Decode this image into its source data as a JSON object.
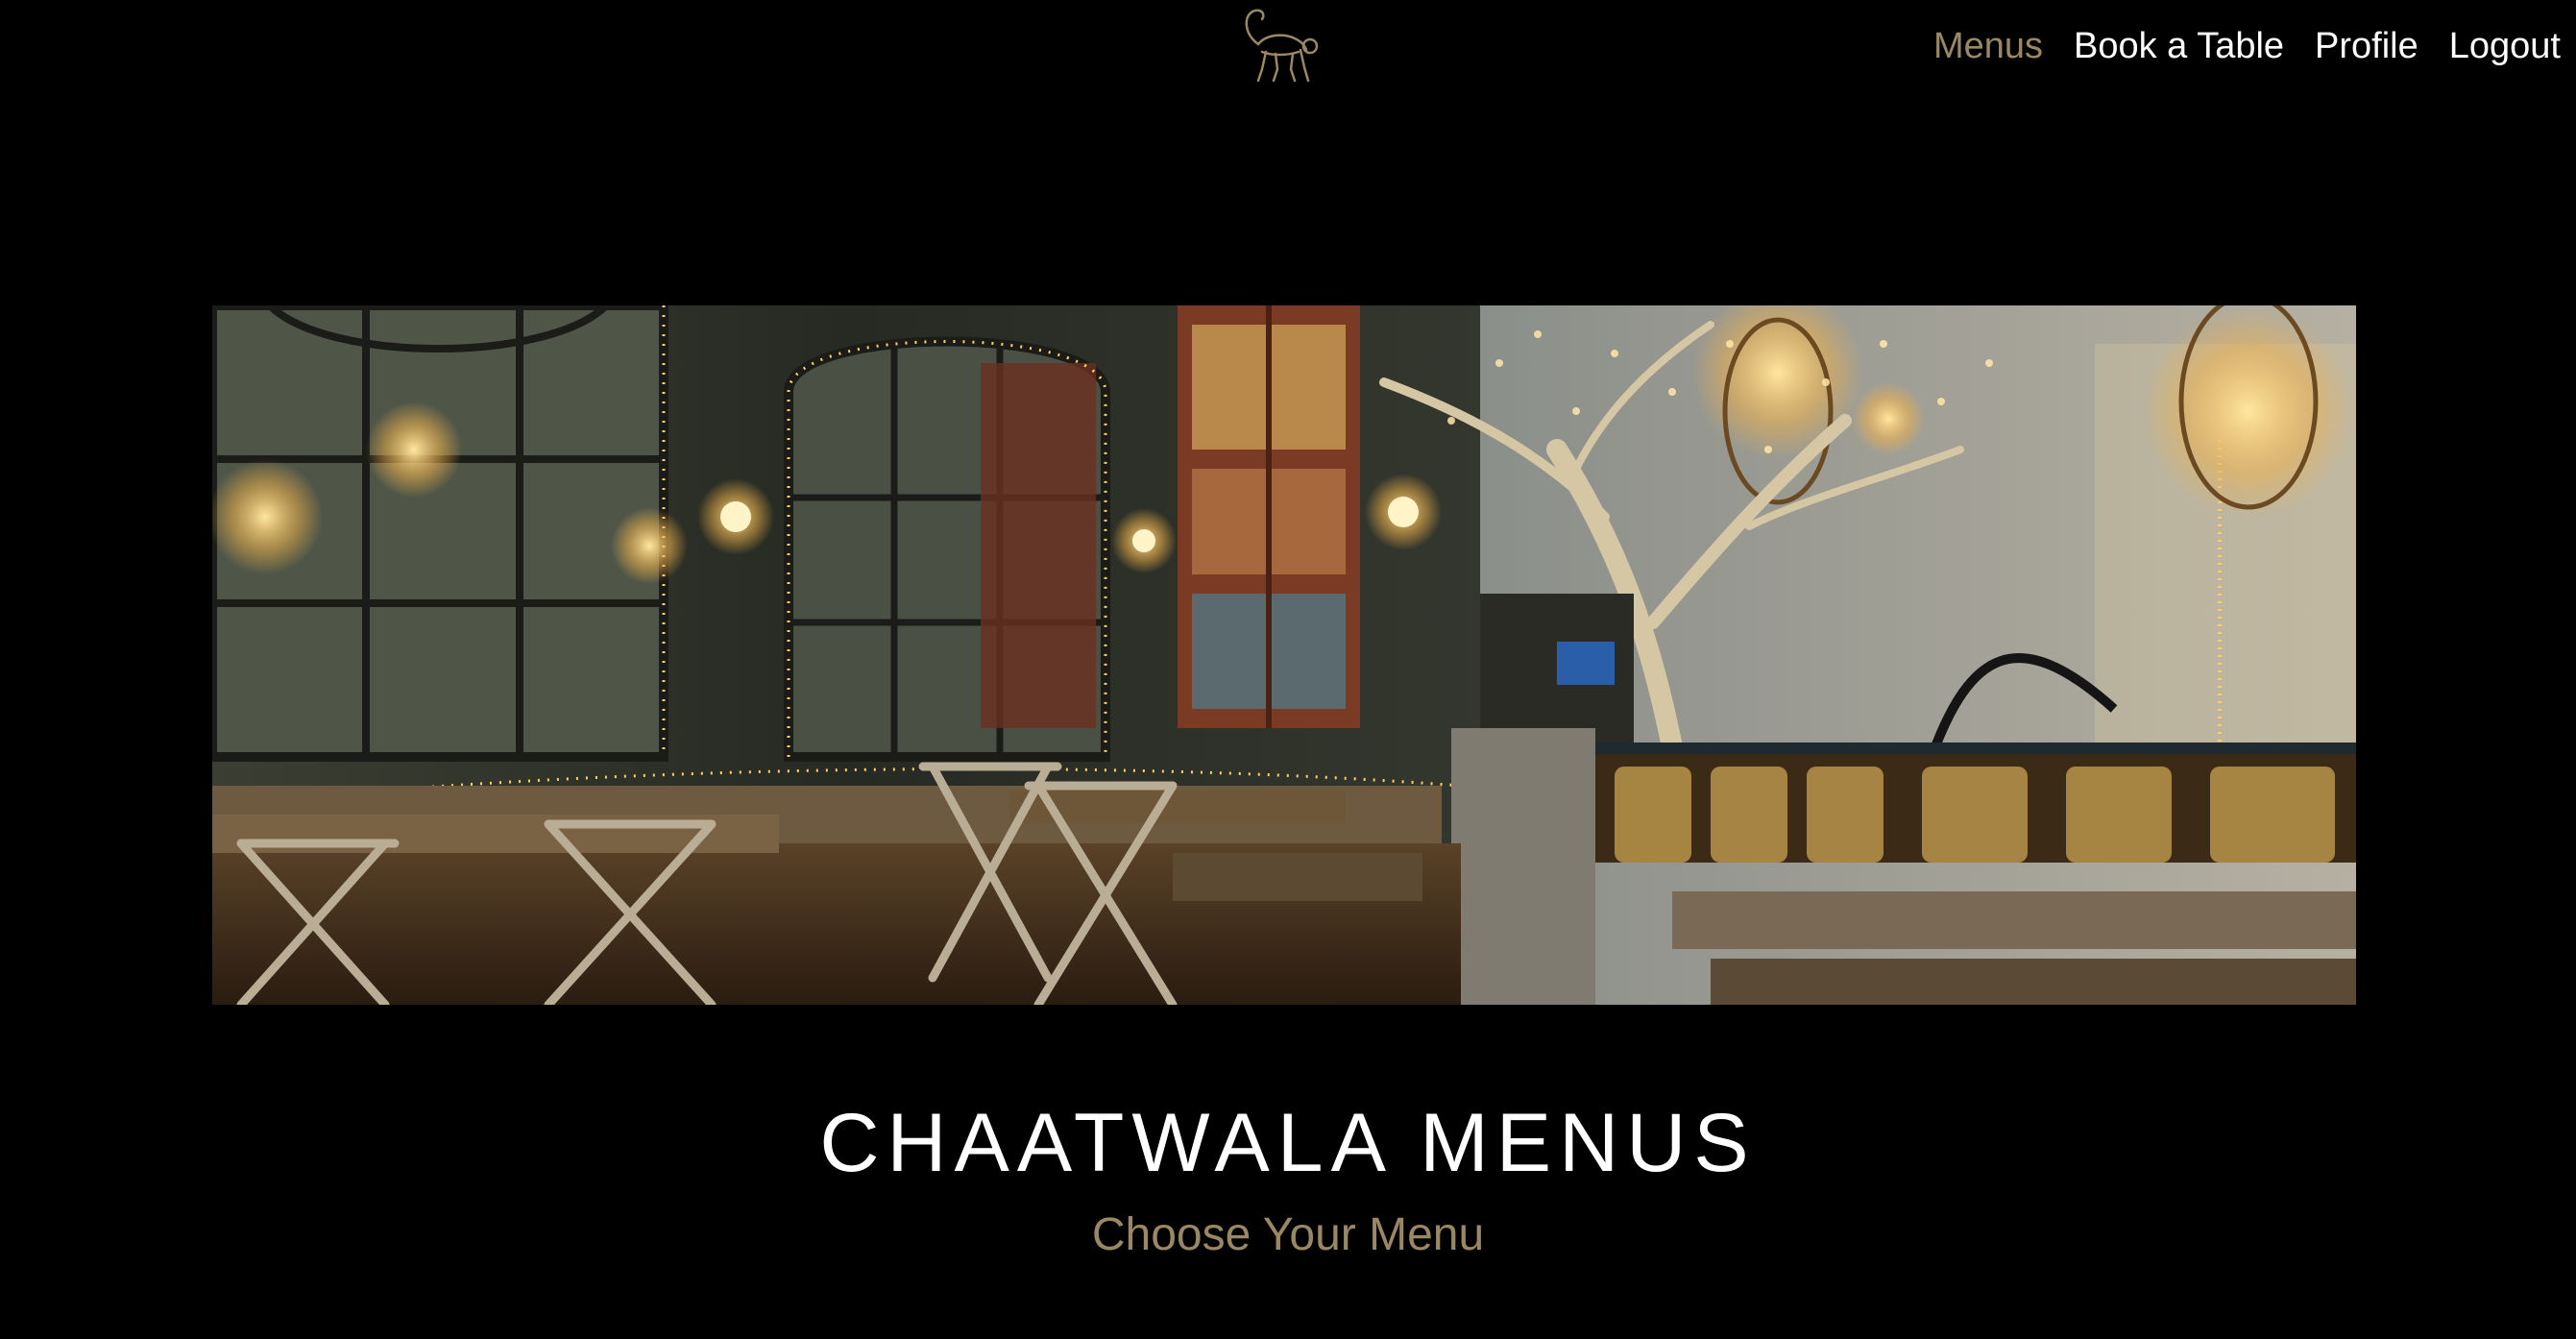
{
  "header": {
    "logo_icon": "monkey-logo-icon",
    "nav": [
      {
        "label": "Menus",
        "active": true
      },
      {
        "label": "Book a Table",
        "active": false
      },
      {
        "label": "Profile",
        "active": false
      },
      {
        "label": "Logout",
        "active": false
      }
    ]
  },
  "hero": {
    "image": "restaurant-interior-photo"
  },
  "content": {
    "title": "CHAATWALA MENUS",
    "subtitle": "Choose Your Menu"
  },
  "colors": {
    "background": "#000000",
    "accent": "#9a8763",
    "text": "#ffffff"
  }
}
